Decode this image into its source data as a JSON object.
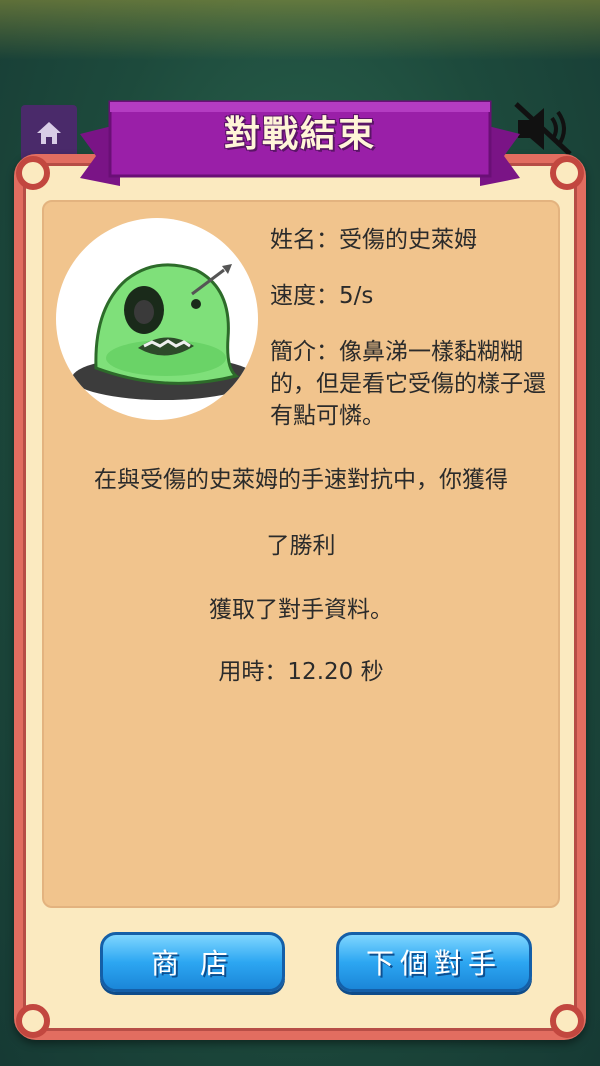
{
  "header": {
    "title": "對戰結束"
  },
  "opponent": {
    "name_label": "姓名：",
    "name": "受傷的史萊姆",
    "speed_label": "速度：",
    "speed": "5/s",
    "intro_label": "簡介：",
    "intro": "像鼻涕一樣黏糊糊的，但是看它受傷的樣子還有點可憐。"
  },
  "result": {
    "line1": "在與受傷的史萊姆的手速對抗中，你獲得",
    "line2": "了勝利",
    "line3": "獲取了對手資料。",
    "time_label": "用時：",
    "time_value": "12.20 秒"
  },
  "buttons": {
    "shop": "商 店",
    "next": "下個對手"
  },
  "icons": {
    "home": "home-icon",
    "mute": "sound-muted-icon"
  },
  "colors": {
    "ribbon": "#9a1fa8",
    "panel_border": "#e26d60",
    "inner_bg": "#f1c48d",
    "button": "#2da7f2"
  }
}
